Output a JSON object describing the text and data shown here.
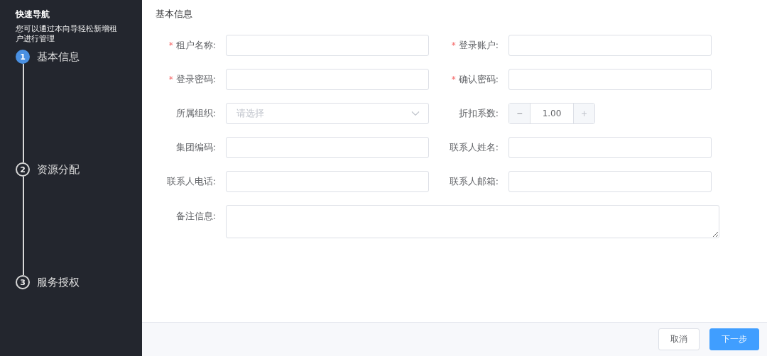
{
  "sidebar": {
    "title": "快速导航",
    "description": "您可以通过本向导轻松新增租户进行管理",
    "steps": [
      {
        "number": "1",
        "label": "基本信息",
        "selected": true
      },
      {
        "number": "2",
        "label": "资源分配",
        "selected": false
      },
      {
        "number": "3",
        "label": "服务授权",
        "selected": false
      }
    ]
  },
  "form": {
    "title": "基本信息",
    "fields": [
      {
        "kind": "text",
        "label": "租户名称:",
        "required_mark": "*"
      },
      {
        "kind": "text",
        "label": "登录账户:",
        "required_mark": "*"
      },
      {
        "kind": "text",
        "label": "登录密码:",
        "required_mark": "*"
      },
      {
        "kind": "text",
        "label": "确认密码:",
        "required_mark": "*"
      },
      {
        "kind": "select",
        "label": "所属组织:",
        "placeholder": "请选择"
      },
      {
        "kind": "number",
        "label": "折扣系数:",
        "value": "1.00",
        "minus": "−",
        "plus": "+"
      },
      {
        "kind": "text",
        "label": "集团编码:"
      },
      {
        "kind": "text",
        "label": "联系人姓名:"
      },
      {
        "kind": "text",
        "label": "联系人电话:"
      },
      {
        "kind": "text",
        "label": "联系人邮箱:"
      },
      {
        "kind": "textarea",
        "label": "备注信息:"
      }
    ]
  },
  "footer": {
    "buttons": [
      {
        "label": "取消",
        "kind": "default"
      },
      {
        "label": "下一步",
        "kind": "primary"
      }
    ]
  }
}
